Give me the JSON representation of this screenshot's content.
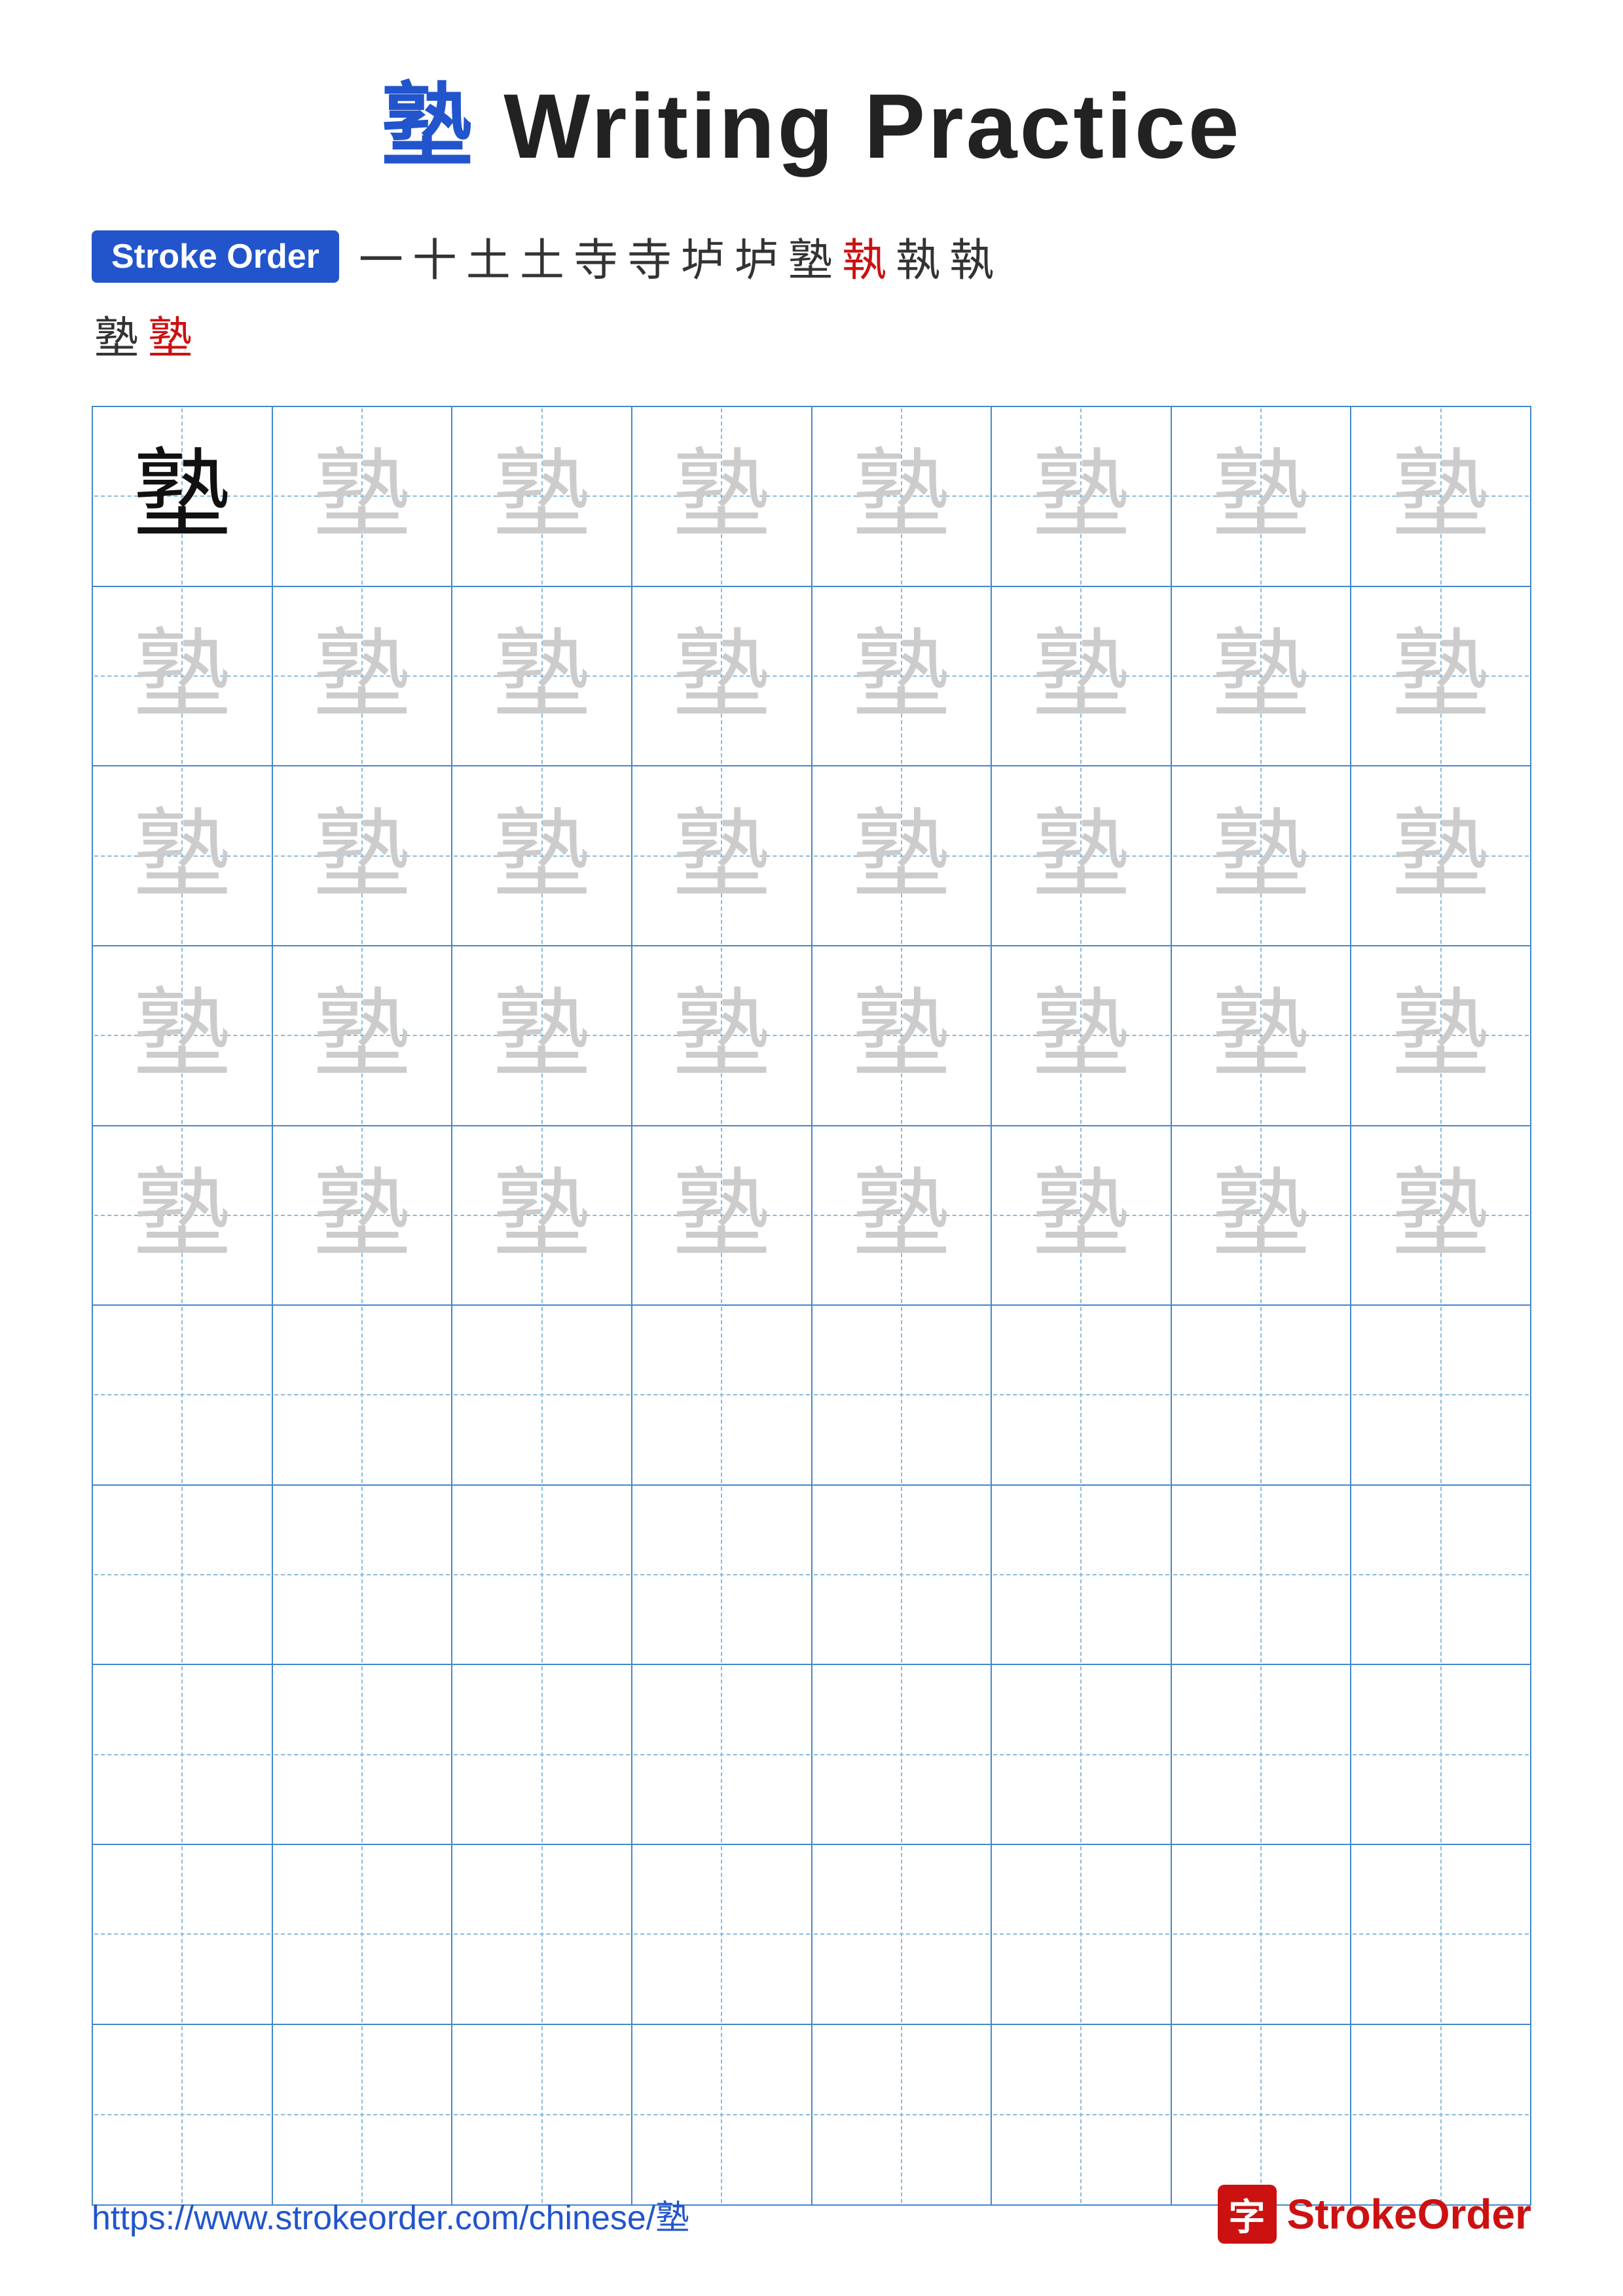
{
  "title": {
    "char": "塾",
    "rest": " Writing Practice"
  },
  "stroke_order": {
    "badge_label": "Stroke Order",
    "chars_row1": [
      "一",
      "十",
      "土",
      "土",
      "寺",
      "寺",
      "垆",
      "垆",
      "塾",
      "執",
      "執",
      "執"
    ],
    "chars_row2_red_index": [
      1
    ],
    "chars_row2": [
      "塾",
      "塾"
    ]
  },
  "grid": {
    "rows": 10,
    "cols": 8,
    "character": "塾",
    "filled_rows": 5,
    "first_cell_dark": true
  },
  "footer": {
    "url": "https://www.strokeorder.com/chinese/塾",
    "brand_char": "字",
    "brand_name_black": "Stroke",
    "brand_name_red": "Order"
  }
}
